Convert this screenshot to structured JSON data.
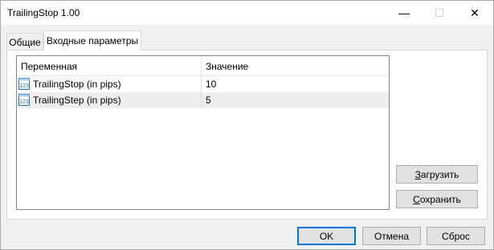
{
  "window": {
    "title": "TrailingStop 1.00",
    "min_glyph": "—",
    "max_glyph": "☐",
    "close_glyph": "✕"
  },
  "tabs": [
    {
      "label": "Общие",
      "active": false
    },
    {
      "label": "Входные параметры",
      "active": true
    }
  ],
  "table": {
    "headers": [
      "Переменная",
      "Значение"
    ],
    "rows": [
      {
        "icon": "numeric-123-icon",
        "name": "TrailingStop (in pips)",
        "value": "10"
      },
      {
        "icon": "numeric-123-icon",
        "name": "TrailingStep (in pips)",
        "value": "5"
      }
    ],
    "icon_text": "123"
  },
  "side_buttons": {
    "load_label_first": "З",
    "load_label_rest": "агрузить",
    "save_label_first": "С",
    "save_label_rest": "охранить"
  },
  "footer_buttons": {
    "ok": "OK",
    "cancel": "Отмена",
    "reset": "Сброс"
  },
  "colors": {
    "default_button_border": "#0078d7",
    "alt_row": "#eeeeee",
    "icon_blue": "#1e73c8"
  }
}
